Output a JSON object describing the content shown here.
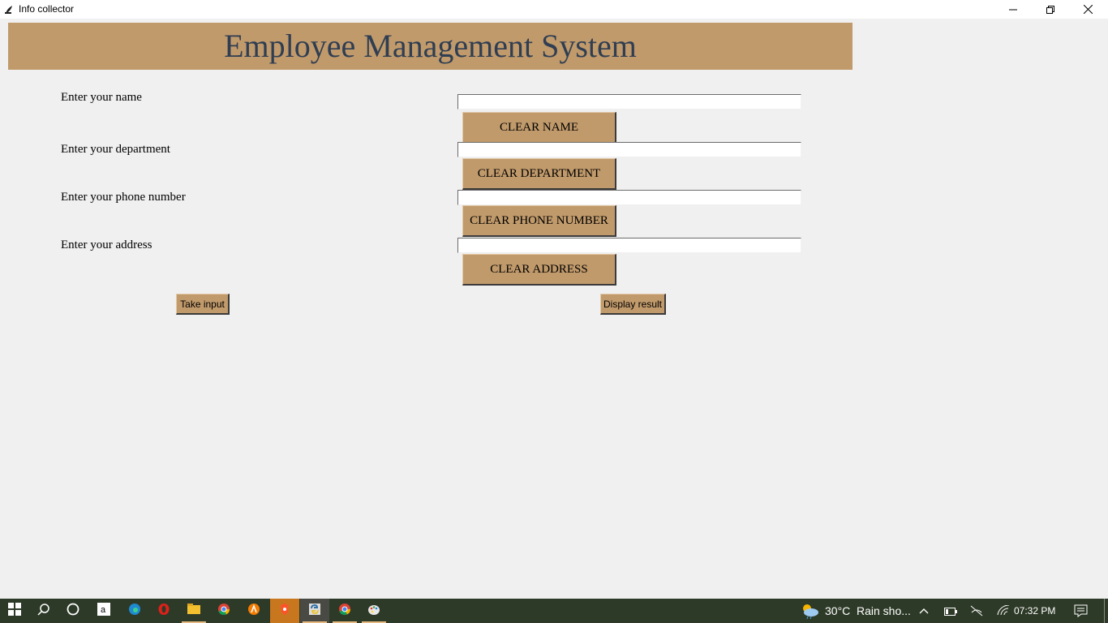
{
  "window": {
    "title": "Info collector",
    "icon": "feather-icon",
    "controls": [
      "minimize-icon",
      "restore-icon",
      "close-icon"
    ]
  },
  "header": {
    "title": "Employee Management System",
    "background": "#c19a6b",
    "text_color": "#2f3e52"
  },
  "form": {
    "fields": [
      {
        "label": "Enter your name",
        "value": "",
        "clear_label": "CLEAR NAME"
      },
      {
        "label": "Enter your department",
        "value": "",
        "clear_label": "CLEAR DEPARTMENT"
      },
      {
        "label": "Enter your phone number",
        "value": "",
        "clear_label": "CLEAR PHONE NUMBER"
      },
      {
        "label": "Enter your address",
        "value": "",
        "clear_label": "CLEAR ADDRESS"
      }
    ],
    "take_input_label": "Take input",
    "display_result_label": "Display result"
  },
  "taskbar": {
    "apps": [
      "windows-start-icon",
      "search-icon",
      "cortana-icon",
      "amazon-icon",
      "edge-icon",
      "opera-icon",
      "file-explorer-icon",
      "chrome-icon",
      "avast-icon",
      "brave-icon",
      "python-icon",
      "chrome-icon",
      "paint-icon"
    ],
    "weather": {
      "temp": "30°C",
      "desc": "Rain sho..."
    },
    "clock": "07:32 PM",
    "tray_icons": [
      "chevron-up-icon",
      "battery-icon",
      "network-off-icon",
      "wifi-icon",
      "notification-icon"
    ]
  }
}
